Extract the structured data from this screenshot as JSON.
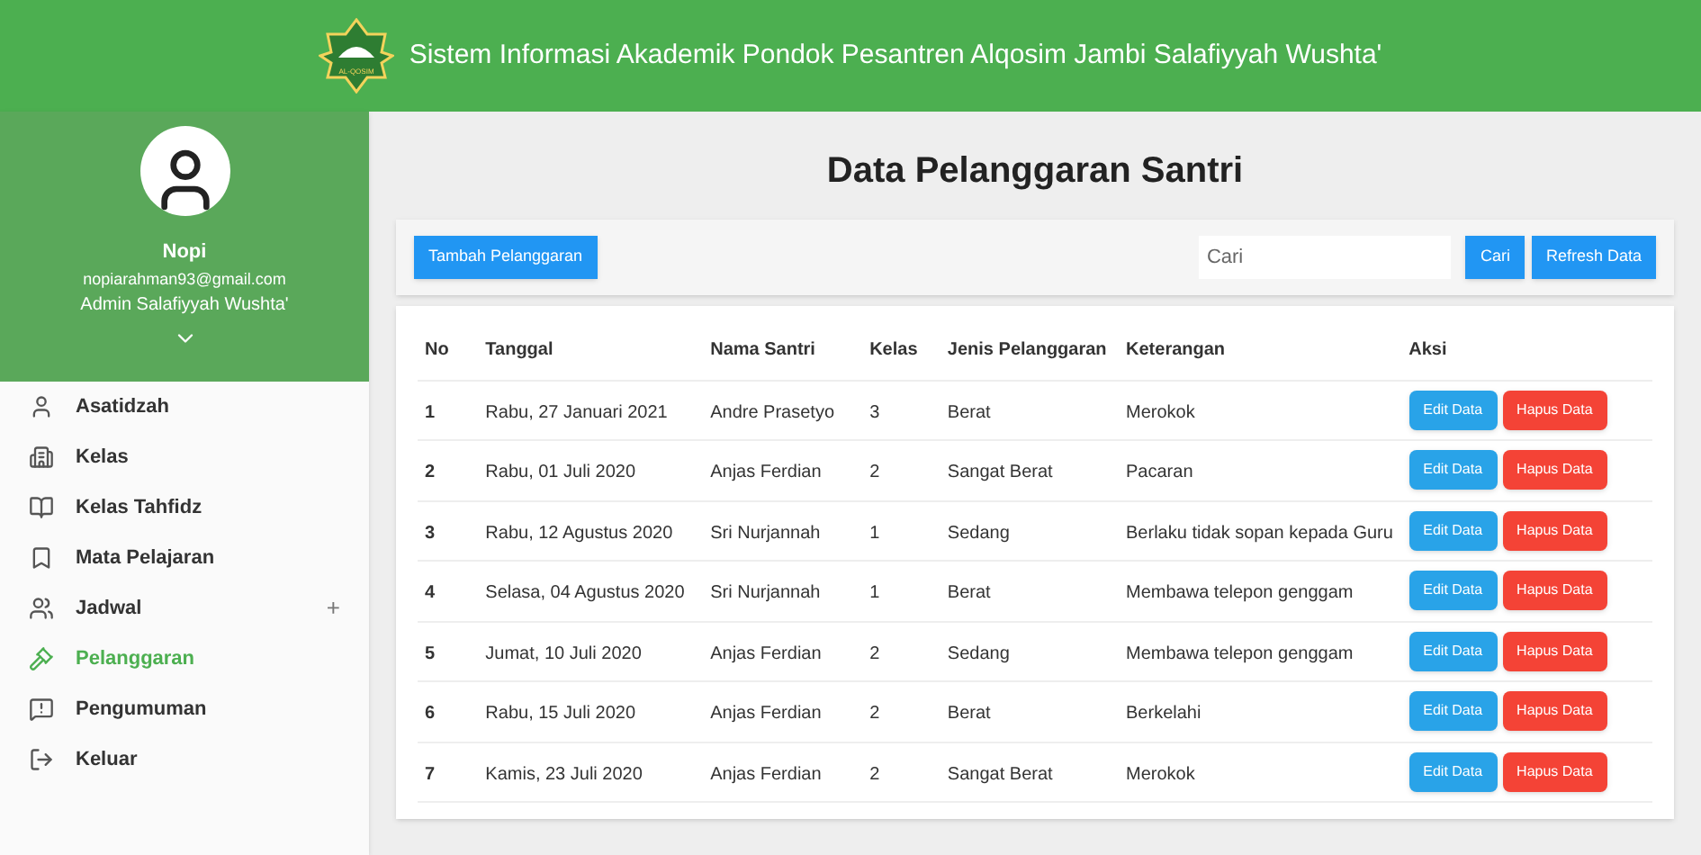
{
  "header": {
    "title": "Sistem Informasi Akademik Pondok Pesantren Alqosim Jambi Salafiyyah Wushta'",
    "logo_text": "AL-QOSIM"
  },
  "profile": {
    "name": "Nopi",
    "email": "nopiarahman93@gmail.com",
    "role": "Admin Salafiyyah Wushta'"
  },
  "sidebar": {
    "items": [
      {
        "label": "Asatidzah",
        "selected": false
      },
      {
        "label": "Kelas",
        "selected": false
      },
      {
        "label": "Kelas Tahfidz",
        "selected": false
      },
      {
        "label": "Mata Pelajaran",
        "selected": false
      },
      {
        "label": "Jadwal",
        "selected": false,
        "toggle": "+"
      },
      {
        "label": "Pelanggaran",
        "selected": true
      },
      {
        "label": "Pengumuman",
        "selected": false
      },
      {
        "label": "Keluar",
        "selected": false
      }
    ]
  },
  "page": {
    "title": "Data Pelanggaran Santri"
  },
  "toolbar": {
    "add_button": "Tambah Pelanggaran",
    "search": {
      "placeholder": "Cari"
    },
    "search_button": "Cari",
    "refresh_button": "Refresh Data"
  },
  "table": {
    "columns": [
      "No",
      "Tanggal",
      "Nama Santri",
      "Kelas",
      "Jenis Pelanggaran",
      "Keterangan",
      "Aksi"
    ],
    "rows": [
      {
        "cells": [
          "1",
          "Rabu, 27 Januari 2021",
          "Andre Prasetyo",
          "3",
          "Berat",
          "Merokok"
        ],
        "actions": [
          "Edit Data",
          "Hapus Data"
        ]
      },
      {
        "cells": [
          "2",
          "Rabu, 01 Juli 2020",
          "Anjas Ferdian",
          "2",
          "Sangat Berat",
          "Pacaran"
        ],
        "actions": [
          "Edit Data",
          "Hapus Data"
        ]
      },
      {
        "cells": [
          "3",
          "Rabu, 12 Agustus 2020",
          "Sri Nurjannah",
          "1",
          "Sedang",
          "Berlaku tidak sopan kepada Guru"
        ],
        "actions": [
          "Edit Data",
          "Hapus Data"
        ]
      },
      {
        "cells": [
          "4",
          "Selasa, 04 Agustus 2020",
          "Sri Nurjannah",
          "1",
          "Berat",
          "Membawa telepon genggam"
        ],
        "actions": [
          "Edit Data",
          "Hapus Data"
        ]
      },
      {
        "cells": [
          "5",
          "Jumat, 10 Juli 2020",
          "Anjas Ferdian",
          "2",
          "Sedang",
          "Membawa telepon genggam"
        ],
        "actions": [
          "Edit Data",
          "Hapus Data"
        ]
      },
      {
        "cells": [
          "6",
          "Rabu, 15 Juli 2020",
          "Anjas Ferdian",
          "2",
          "Berat",
          "Berkelahi"
        ],
        "actions": [
          "Edit Data",
          "Hapus Data"
        ]
      },
      {
        "cells": [
          "7",
          "Kamis, 23 Juli 2020",
          "Anjas Ferdian",
          "2",
          "Sangat Berat",
          "Merokok"
        ],
        "actions": [
          "Edit Data",
          "Hapus Data"
        ]
      }
    ]
  }
}
